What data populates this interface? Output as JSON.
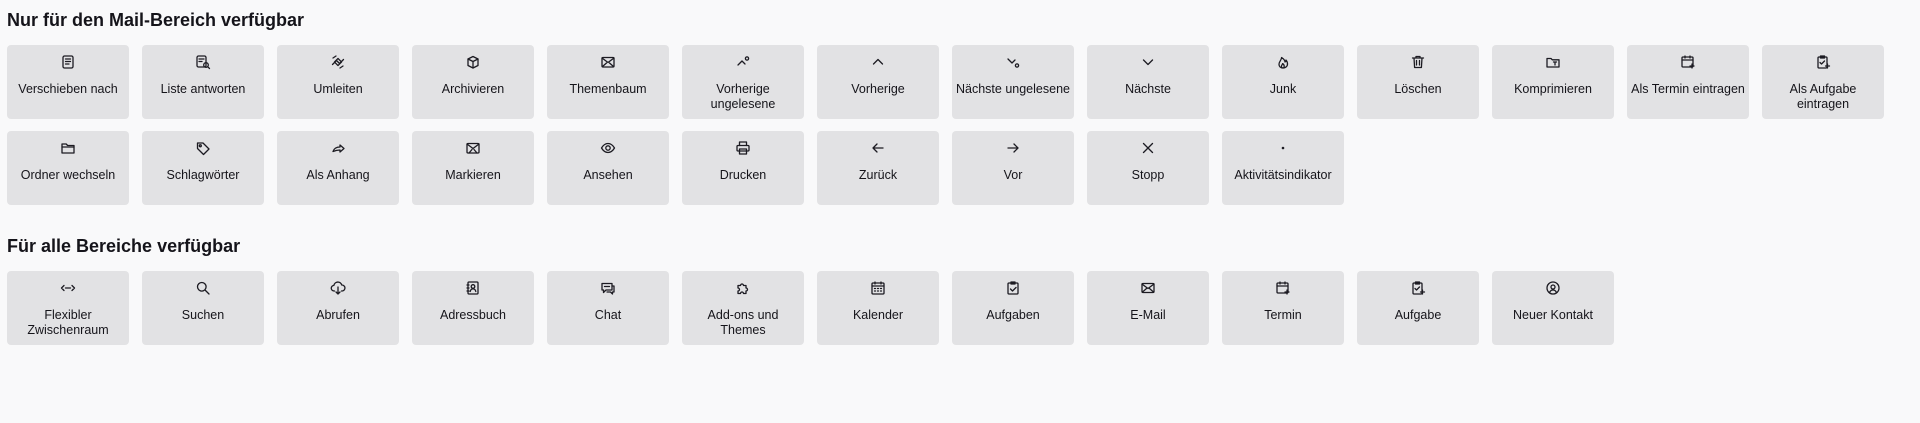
{
  "sections": [
    {
      "title": "Nur für den Mail-Bereich verfügbar",
      "tiles": [
        {
          "label": "Verschieben nach",
          "icon": "move-to-icon"
        },
        {
          "label": "Liste antworten",
          "icon": "reply-list-icon"
        },
        {
          "label": "Umleiten",
          "icon": "redirect-icon"
        },
        {
          "label": "Archivieren",
          "icon": "archive-icon"
        },
        {
          "label": "Themenbaum",
          "icon": "thread-tree-icon"
        },
        {
          "label": "Vorherige ungelesene",
          "icon": "previous-unread-icon"
        },
        {
          "label": "Vorherige",
          "icon": "chevron-up-icon"
        },
        {
          "label": "Nächste ungelesene",
          "icon": "next-unread-icon"
        },
        {
          "label": "Nächste",
          "icon": "chevron-down-icon"
        },
        {
          "label": "Junk",
          "icon": "junk-flame-icon"
        },
        {
          "label": "Löschen",
          "icon": "trash-icon"
        },
        {
          "label": "Komprimieren",
          "icon": "compact-folder-icon"
        },
        {
          "label": "Als Termin eintragen",
          "icon": "calendar-add-icon"
        },
        {
          "label": "Als Aufgabe eintragen",
          "icon": "task-add-icon"
        },
        {
          "label": "Ordner wechseln",
          "icon": "folder-icon"
        },
        {
          "label": "Schlagwörter",
          "icon": "tag-icon"
        },
        {
          "label": "Als Anhang",
          "icon": "forward-attachment-icon"
        },
        {
          "label": "Markieren",
          "icon": "mark-mail-icon"
        },
        {
          "label": "Ansehen",
          "icon": "eye-icon"
        },
        {
          "label": "Drucken",
          "icon": "printer-icon"
        },
        {
          "label": "Zurück",
          "icon": "arrow-left-icon"
        },
        {
          "label": "Vor",
          "icon": "arrow-right-icon"
        },
        {
          "label": "Stopp",
          "icon": "close-icon"
        },
        {
          "label": "Aktivitätsindikator",
          "icon": "activity-dot-icon"
        }
      ]
    },
    {
      "title": "Für alle Bereiche verfügbar",
      "tiles": [
        {
          "label": "Flexibler Zwischenraum",
          "icon": "flexible-space-icon"
        },
        {
          "label": "Suchen",
          "icon": "search-icon"
        },
        {
          "label": "Abrufen",
          "icon": "cloud-download-icon"
        },
        {
          "label": "Adressbuch",
          "icon": "address-book-icon"
        },
        {
          "label": "Chat",
          "icon": "chat-icon"
        },
        {
          "label": "Add-ons und Themes",
          "icon": "puzzle-icon"
        },
        {
          "label": "Kalender",
          "icon": "calendar-icon"
        },
        {
          "label": "Aufgaben",
          "icon": "clipboard-check-icon"
        },
        {
          "label": "E-Mail",
          "icon": "envelope-icon"
        },
        {
          "label": "Termin",
          "icon": "calendar-plus-icon"
        },
        {
          "label": "Aufgabe",
          "icon": "task-plus-icon"
        },
        {
          "label": "Neuer Kontakt",
          "icon": "new-contact-icon"
        }
      ]
    }
  ]
}
